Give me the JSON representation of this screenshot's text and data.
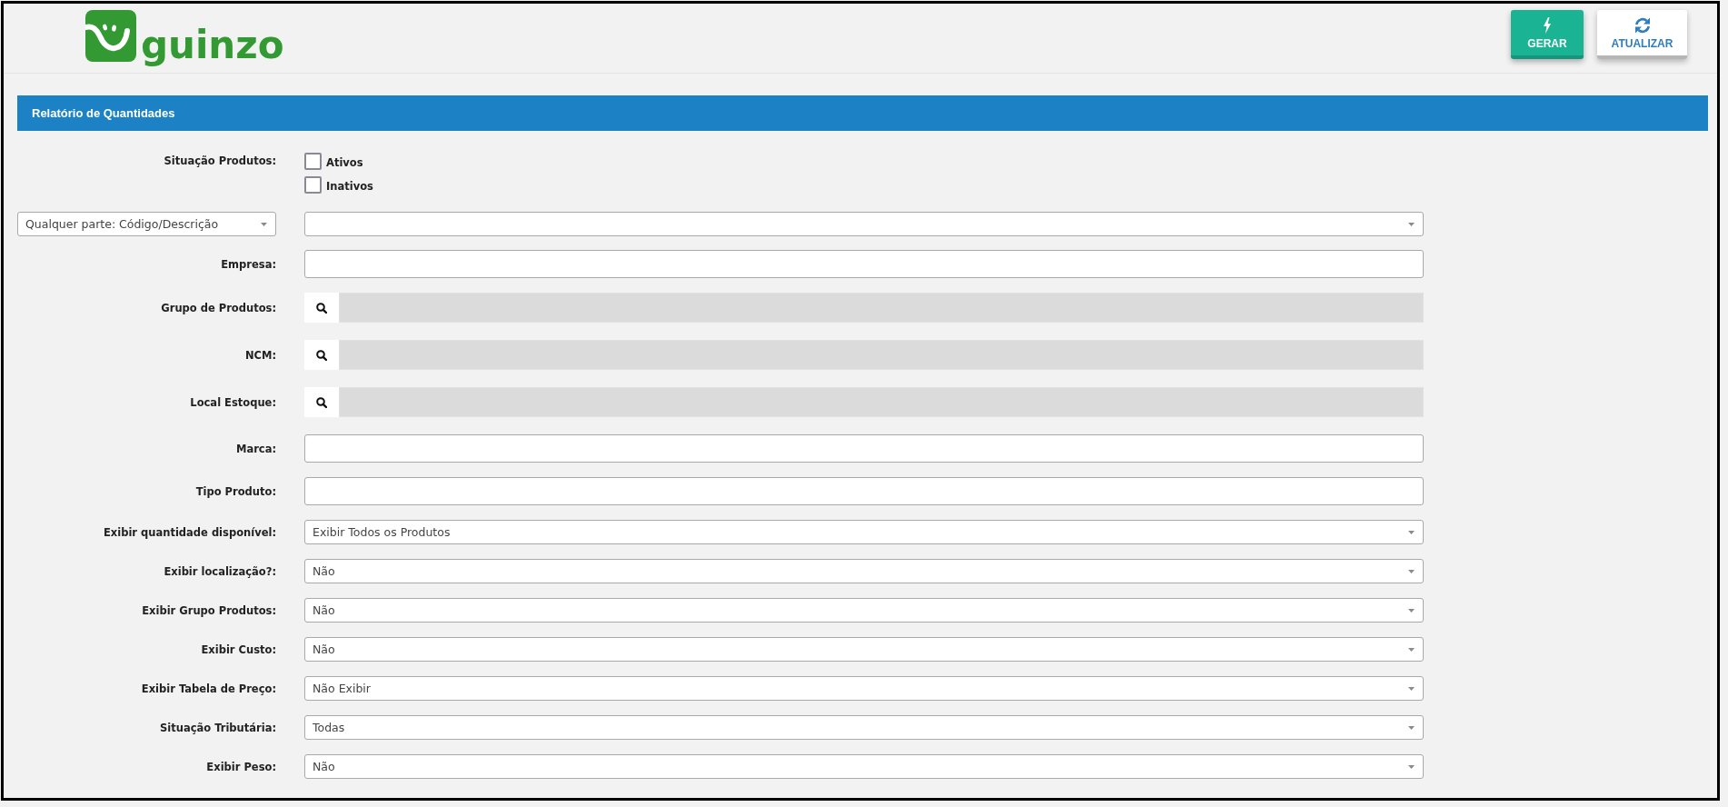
{
  "header": {
    "logo": {
      "text": "guinzo"
    },
    "buttons": [
      {
        "label": "GERAR",
        "kind": "generate"
      },
      {
        "label": "ATUALIZAR",
        "kind": "refresh"
      }
    ]
  },
  "panel": {
    "title": "Relatório de Quantidades",
    "rows": [
      {
        "kind": "checkboxes",
        "label": "Situação Produtos:",
        "options": [
          {
            "label": "Ativos",
            "checked": false
          },
          {
            "label": "Inativos",
            "checked": false
          }
        ]
      },
      {
        "kind": "filter",
        "mode": "Qualquer parte: Código/Descrição"
      },
      {
        "kind": "text",
        "label": "Empresa:"
      },
      {
        "kind": "lookup",
        "label": "Grupo de Produtos:"
      },
      {
        "kind": "lookup",
        "label": "NCM:"
      },
      {
        "kind": "lookup",
        "label": "Local Estoque:"
      },
      {
        "kind": "text",
        "label": "Marca:"
      },
      {
        "kind": "text",
        "label": "Tipo Produto:"
      },
      {
        "kind": "select",
        "label": "Exibir quantidade disponível:",
        "value": "Exibir Todos os Produtos"
      },
      {
        "kind": "select",
        "label": "Exibir localização?:",
        "value": "Não"
      },
      {
        "kind": "select",
        "label": "Exibir Grupo Produtos:",
        "value": "Não"
      },
      {
        "kind": "select",
        "label": "Exibir Custo:",
        "value": "Não"
      },
      {
        "kind": "select",
        "label": "Exibir Tabela de Preço:",
        "value": "Não Exibir"
      },
      {
        "kind": "select",
        "label": "Situação Tributária:",
        "value": "Todas"
      },
      {
        "kind": "select",
        "label": "Exibir Peso:",
        "value": "Não"
      }
    ]
  }
}
